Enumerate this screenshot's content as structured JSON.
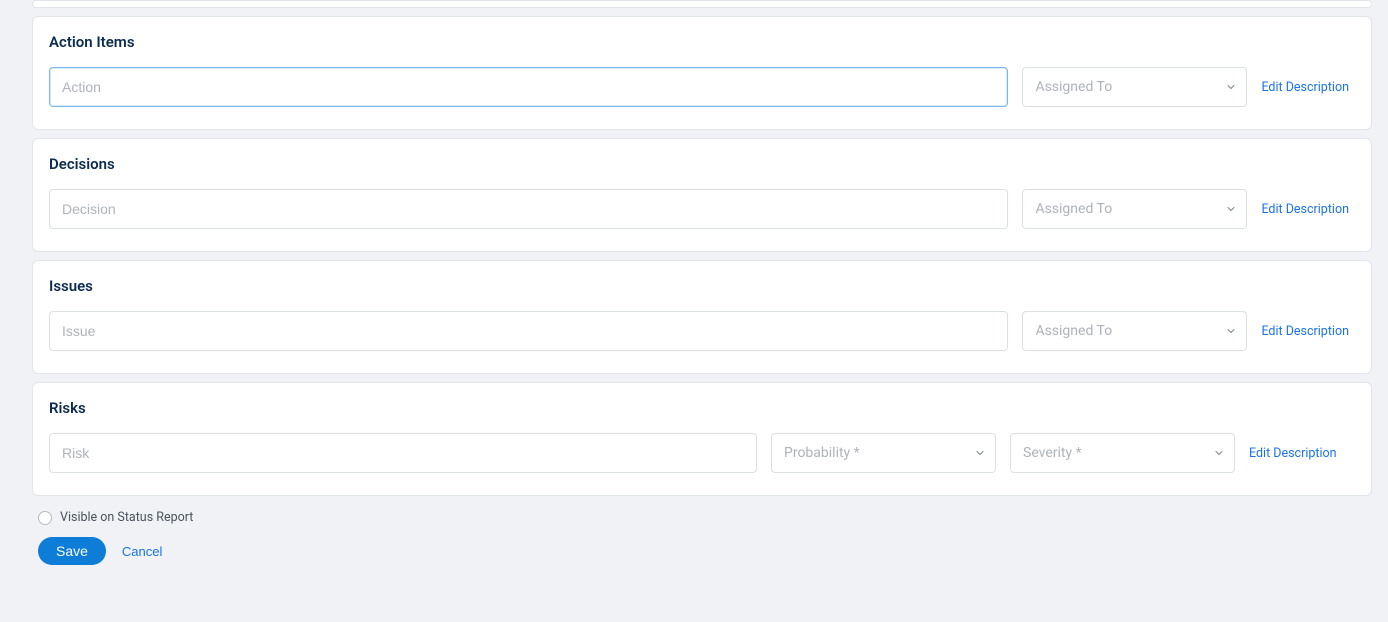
{
  "sections": {
    "actionItems": {
      "title": "Action Items",
      "textPlaceholder": "Action",
      "assignPlaceholder": "Assigned To",
      "editLink": "Edit Description"
    },
    "decisions": {
      "title": "Decisions",
      "textPlaceholder": "Decision",
      "assignPlaceholder": "Assigned To",
      "editLink": "Edit Description"
    },
    "issues": {
      "title": "Issues",
      "textPlaceholder": "Issue",
      "assignPlaceholder": "Assigned To",
      "editLink": "Edit Description"
    },
    "risks": {
      "title": "Risks",
      "textPlaceholder": "Risk",
      "probabilityPlaceholder": "Probability *",
      "severityPlaceholder": "Severity *",
      "editLink": "Edit Description"
    }
  },
  "footer": {
    "visibleLabel": "Visible on Status Report",
    "saveLabel": "Save",
    "cancelLabel": "Cancel"
  }
}
